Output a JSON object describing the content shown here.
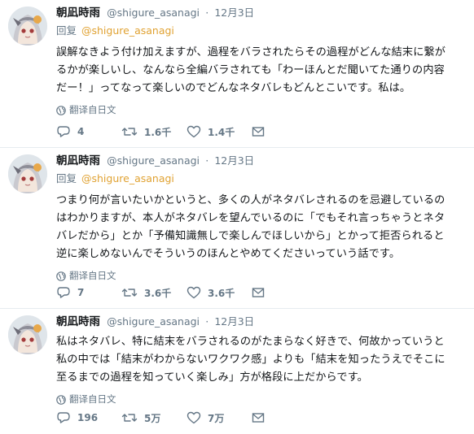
{
  "tweets": [
    {
      "name": "朝凪時雨",
      "handle": "@shigure_asanagi",
      "dot": "·",
      "date": "12月3日",
      "reply_label": "回复",
      "reply_to": "@shigure_asanagi",
      "lines": [
        "誤解なきよう付け加えますが、過程をバラされたらその過程がどんな結末に繋が",
        "るかが楽しいし、なんなら全編バラされても「わーほんとだ聞いてた通りの内容",
        "だー！」ってなって楽しいのでどんなネタバレもどんとこいです。私は。"
      ],
      "translate": "翻译自日文",
      "replies": "4",
      "retweets": "1.6千",
      "likes": "1.4千"
    },
    {
      "name": "朝凪時雨",
      "handle": "@shigure_asanagi",
      "dot": "·",
      "date": "12月3日",
      "reply_label": "回复",
      "reply_to": "@shigure_asanagi",
      "lines": [
        "つまり何が言いたいかというと、多くの人がネタバレされるのを忌避しているの",
        "はわかりますが、本人がネタバレを望んでいるのに「でもそれ言っちゃうとネタ",
        "バレだから」とか「予備知識無しで楽しんでほしいから」とかって拒否られると",
        "逆に楽しめないんでそういうのほんとやめてくださいっていう話です。"
      ],
      "translate": "翻译自日文",
      "replies": "7",
      "retweets": "3.6千",
      "likes": "3.6千"
    },
    {
      "name": "朝凪時雨",
      "handle": "@shigure_asanagi",
      "dot": "·",
      "date": "12月3日",
      "lines": [
        "私はネタバレ、特に結末をバラされるのがたまらなく好きで、何故かっていうと",
        "私の中では「結末がわからないワクワク感」よりも「結末を知ったうえでそこに",
        "至るまでの過程を知っていく楽しみ」方が格段に上だからです。"
      ],
      "translate": "翻译自日文",
      "replies": "196",
      "retweets": "5万",
      "likes": "7万"
    }
  ],
  "icons": {
    "reply": "speech-bubble-icon",
    "retweet": "retweet-arrows-icon",
    "like": "heart-icon",
    "dm": "envelope-icon",
    "translate": "globe-icon"
  },
  "colors": {
    "text": "#14171a",
    "muted": "#657786",
    "mention": "#e0a232",
    "divider": "#e6ecf0"
  }
}
